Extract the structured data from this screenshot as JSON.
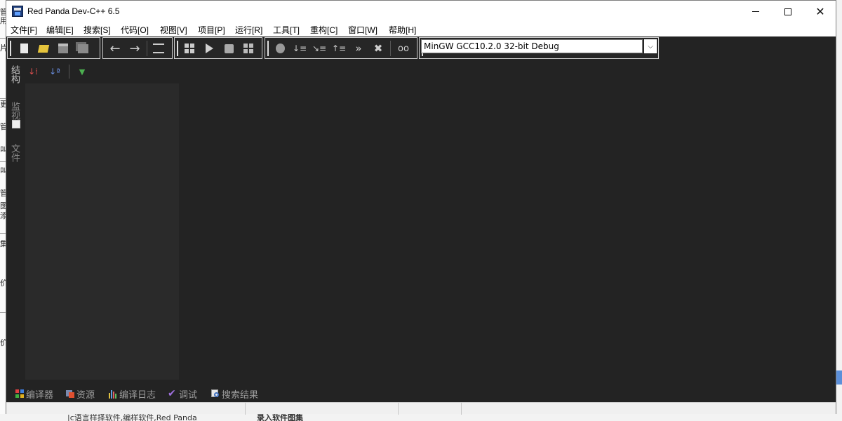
{
  "window": {
    "title": "Red Panda Dev-C++ 6.5"
  },
  "menu": {
    "items": [
      "文件[F]",
      "编辑[E]",
      "搜索[S]",
      "代码[O]",
      "视图[V]",
      "项目[P]",
      "运行[R]",
      "工具[T]",
      "重构[C]",
      "窗口[W]",
      "帮助[H]"
    ]
  },
  "toolbar": {
    "compiler_selected": "MinGW GCC10.2.0 32-bit Debug"
  },
  "left_dock": {
    "tabs": [
      "结构",
      "监视",
      "文件"
    ]
  },
  "bottom_tabs": [
    "编译器",
    "资源",
    "编译日志",
    "调试",
    "搜索结果"
  ],
  "background_window": {
    "side_chars": [
      "管",
      "用",
      "片",
      "更",
      "管",
      "叫",
      "叫",
      "管",
      "图",
      "添",
      "集",
      "价",
      "价"
    ],
    "bottom_left_text": "|c语言样择软件,编样软件,Red Panda",
    "bottom_right_text": "录入软件图集"
  },
  "colors": {
    "window_bg": "#232323",
    "panel_bg": "#2a2a2a",
    "accent_blue": "#5b8fd9"
  }
}
